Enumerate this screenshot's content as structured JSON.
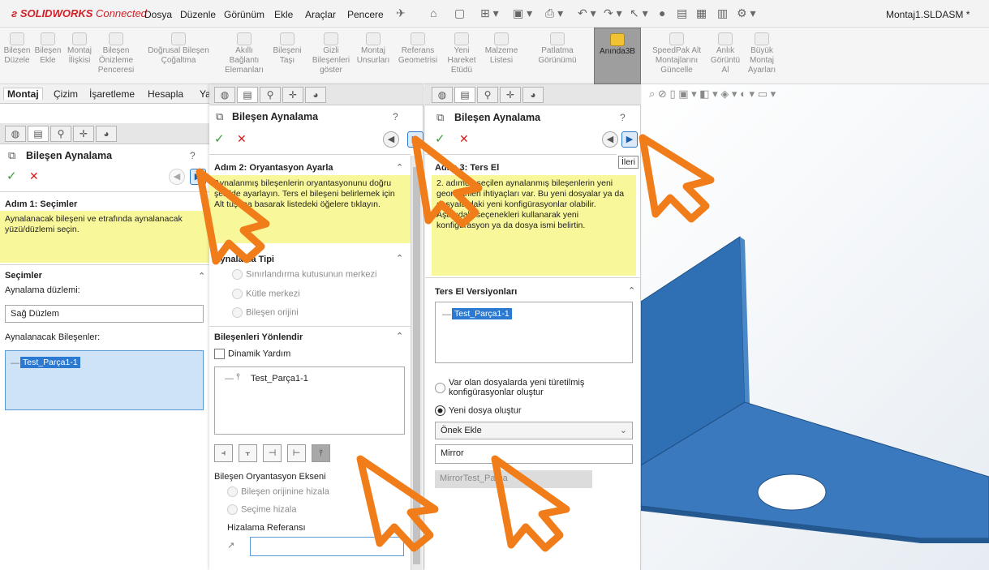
{
  "app": {
    "logo_brand": "SOLIDWORKS",
    "logo_suffix": "Connected",
    "document_title": "Montaj1.SLDASM *"
  },
  "menu": [
    "Dosya",
    "Düzenle",
    "Görünüm",
    "Ekle",
    "Araçlar",
    "Pencere"
  ],
  "command_manager": [
    {
      "label": "Bileşen\nDüzele"
    },
    {
      "label": "Bileşen\nEkle"
    },
    {
      "label": "Montaj\nİlişkisi"
    },
    {
      "label": "Bileşen\nÖnizleme\nPenceresi"
    },
    {
      "label": "Doğrusal Bileşen\nÇoğaltma"
    },
    {
      "label": "Akıllı\nBağlantı\nElemanları"
    },
    {
      "label": "Bileşeni\nTaşı"
    },
    {
      "label": "Gizli\nBileşenleri\ngöster"
    },
    {
      "label": "Montaj\nUnsurları"
    },
    {
      "label": "Referans\nGeometrisi"
    },
    {
      "label": "Yeni\nHareket\nEtüdü"
    },
    {
      "label": "Malzeme\nListesi"
    },
    {
      "label": "Patlatma\nGörünümü"
    },
    {
      "label": "Anında3B"
    },
    {
      "label": "SpeedPak Alt\nMontajlarını\nGüncelle"
    },
    {
      "label": "Anlık\nGörüntü\nAl"
    },
    {
      "label": "Büyük\nMontaj\nAyarları"
    }
  ],
  "tabs": [
    "Montaj",
    "Çizim",
    "İşaretleme",
    "Hesapla",
    "Ya"
  ],
  "panel1": {
    "title": "Bileşen Aynalama",
    "step_header": "Adım 1: Seçimler",
    "message": "Aynalanacak bileşeni ve etrafında aynalanacak yüzü/düzlemi seçin.",
    "sections_header": "Seçimler",
    "plane_label": "Aynalama düzlemi:",
    "plane_value": "Sağ Düzlem",
    "components_label": "Aynalanacak Bileşenler:",
    "component_item": "Test_Parça1-1"
  },
  "panel2": {
    "title": "Bileşen Aynalama",
    "step_header": "Adım 2: Oryantasyon Ayarla",
    "message": "Aynalanmış bileşenlerin oryantasyonunu doğru şekilde ayarlayın. Ters el bileşeni belirlemek için Alt tuşuna basarak listedeki öğelere tıklayın.",
    "mirror_type_header": "Aynalama Tipi",
    "mirror_type_options": [
      "Sınırlandırma kutusunun merkezi",
      "Kütle merkezi",
      "Bileşen orijini"
    ],
    "orient_header": "Bileşenleri Yönlendir",
    "dynamic_help": "Dinamik Yardım",
    "orient_item": "Test_Parça1-1",
    "axis_label": "Bileşen Oryantasyon Ekseni",
    "axis_options": [
      "Bileşen orijinine hizala",
      "Seçime hizala"
    ],
    "align_ref_label": "Hizalama Referansı"
  },
  "panel3": {
    "title": "Bileşen Aynalama",
    "step_header": "Adım 3: Ters El",
    "message": "2. adımda seçilen aynalanmış bileşenlerin yeni geometrileri ihtiyaçları var. Bu yeni dosyalar ya da dosyalardaki yeni konfigürasyonlar olabilir. Aşağıdaki seçenekleri kullanarak yeni konfigürasyon ya da dosya ismi belirtin.",
    "versions_header": "Ters El Versiyonları",
    "version_item": "Test_Parça1-1",
    "option_existing": "Var olan dosyalarda yeni türetilmiş konfigürasyonlar oluştur",
    "option_new": "Yeni dosya oluştur",
    "dropdown_value": "Önek Ekle",
    "prefix_value": "Mirror",
    "preview_value": "MirrorTest_Parça",
    "tooltip": "İleri"
  },
  "colors": {
    "part_blue": "#2f6fb3",
    "highlight_yellow": "#f8f79a",
    "arrow_orange": "#f07d1a",
    "selection_blue": "#2b79d0"
  }
}
